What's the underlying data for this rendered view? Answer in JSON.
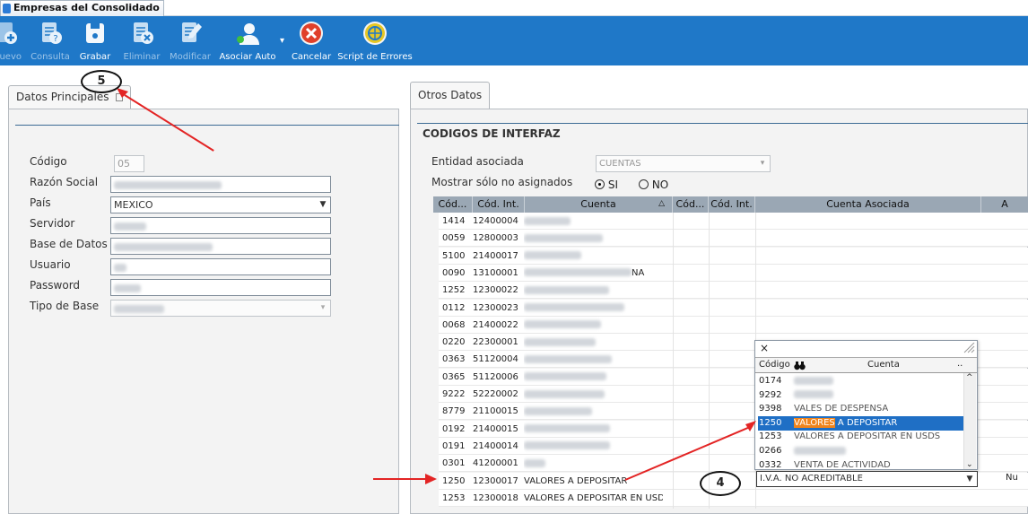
{
  "window": {
    "tab_title": "Empresas del Consolidado"
  },
  "toolbar": {
    "nuevo": "uevo",
    "consulta": "Consulta",
    "grabar": "Grabar",
    "eliminar": "Eliminar",
    "modificar": "Modificar",
    "asociar": "Asociar Auto",
    "cancelar": "Cancelar",
    "script": "Script de Errores"
  },
  "left_panel": {
    "tab": "Datos Principales",
    "fields": {
      "codigo_label": "Código",
      "codigo_value": "05",
      "razon_label": "Razón Social",
      "pais_label": "País",
      "pais_value": "MEXICO",
      "servidor_label": "Servidor",
      "base_label": "Base de Datos",
      "usuario_label": "Usuario",
      "password_label": "Password",
      "tipo_label": "Tipo de Base"
    }
  },
  "right_panel": {
    "tab": "Otros Datos",
    "section_title": "CODIGOS DE INTERFAZ",
    "entidad_label": "Entidad asociada",
    "entidad_value": "CUENTAS",
    "mostrar_label": "Mostrar sólo no asignados",
    "radio_si": "SI",
    "radio_no": "NO",
    "grid": {
      "headers": [
        "Cód...",
        "Cód. Int.",
        "Cuenta",
        "Cód...",
        "Cód. Int.",
        "Cuenta Asociada",
        "A"
      ],
      "rows": [
        {
          "c1": "1414",
          "c2": "12400004",
          "c3": ""
        },
        {
          "c1": "0059",
          "c2": "12800003",
          "c3": ""
        },
        {
          "c1": "5100",
          "c2": "21400017",
          "c3": ""
        },
        {
          "c1": "0090",
          "c2": "13100001",
          "c3": "NA"
        },
        {
          "c1": "1252",
          "c2": "12300022",
          "c3": ""
        },
        {
          "c1": "0112",
          "c2": "12300023",
          "c3": ""
        },
        {
          "c1": "0068",
          "c2": "21400022",
          "c3": ""
        },
        {
          "c1": "0220",
          "c2": "22300001",
          "c3": ""
        },
        {
          "c1": "0363",
          "c2": "51120004",
          "c3": ""
        },
        {
          "c1": "0365",
          "c2": "51120006",
          "c3": ""
        },
        {
          "c1": "9222",
          "c2": "52220002",
          "c3": ""
        },
        {
          "c1": "8779",
          "c2": "21100015",
          "c3": ""
        },
        {
          "c1": "0192",
          "c2": "21400015",
          "c3": ""
        },
        {
          "c1": "0191",
          "c2": "21400014",
          "c3": ""
        },
        {
          "c1": "0301",
          "c2": "41200001",
          "c3": ""
        },
        {
          "c1": "1250",
          "c2": "12300017",
          "c3": "VALORES A DEPOSITAR"
        },
        {
          "c1": "1253",
          "c2": "12300018",
          "c3": "VALORES A DEPOSITAR EN USDS"
        }
      ]
    }
  },
  "popup": {
    "close": "×",
    "col_codigo": "Código",
    "col_cuenta": "Cuenta",
    "scroll_dots": "..",
    "rows": [
      {
        "code": "0174",
        "name": ""
      },
      {
        "code": "9292",
        "name": ""
      },
      {
        "code": "9398",
        "name": "VALES DE DESPENSA"
      },
      {
        "code": "1250",
        "name_hl": "VALORES",
        "name_rest": " A DEPOSITAR"
      },
      {
        "code": "1253",
        "name": "VALORES A DEPOSITAR EN USDS"
      },
      {
        "code": "0266",
        "name": ""
      },
      {
        "code": "0332",
        "name": "VENTA DE ACTIVIDAD"
      }
    ],
    "combo_value": "I.V.A. NO ACREDITABLE",
    "right_cut": "Nu"
  },
  "annotations": {
    "mark5": "5",
    "mark4": "4"
  },
  "colors": {
    "toolbar": "#1f78c8",
    "selection": "#1f6fc5",
    "highlight": "#f0841c",
    "annotation_arrow": "#e32424"
  }
}
